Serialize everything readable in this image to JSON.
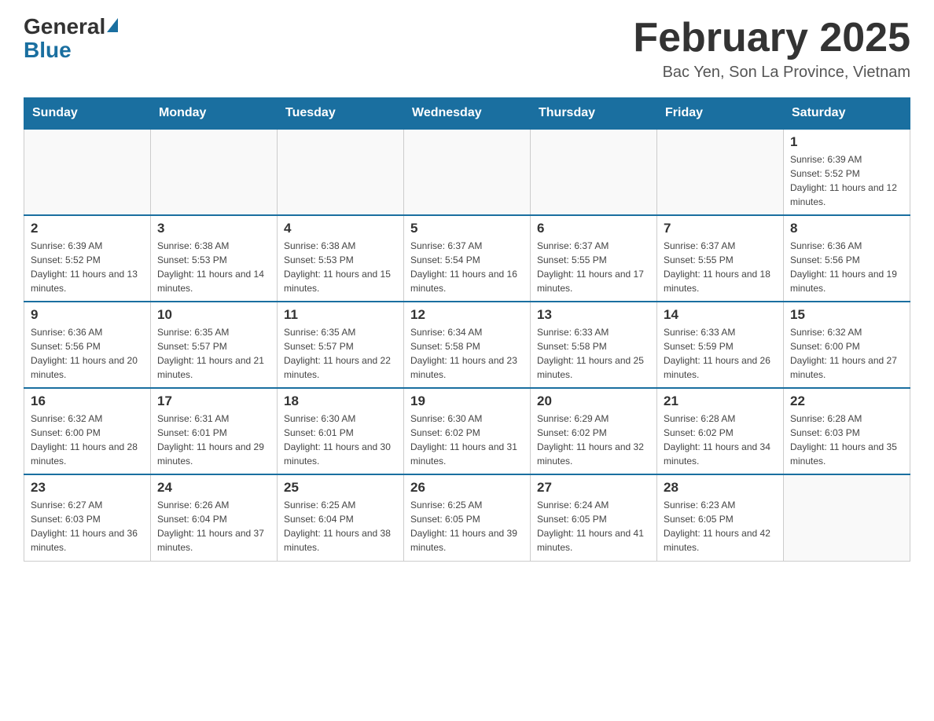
{
  "header": {
    "logo": {
      "general": "General",
      "blue": "Blue"
    },
    "title": "February 2025",
    "location": "Bac Yen, Son La Province, Vietnam"
  },
  "days_of_week": [
    "Sunday",
    "Monday",
    "Tuesday",
    "Wednesday",
    "Thursday",
    "Friday",
    "Saturday"
  ],
  "weeks": [
    [
      {
        "day": "",
        "info": ""
      },
      {
        "day": "",
        "info": ""
      },
      {
        "day": "",
        "info": ""
      },
      {
        "day": "",
        "info": ""
      },
      {
        "day": "",
        "info": ""
      },
      {
        "day": "",
        "info": ""
      },
      {
        "day": "1",
        "info": "Sunrise: 6:39 AM\nSunset: 5:52 PM\nDaylight: 11 hours and 12 minutes."
      }
    ],
    [
      {
        "day": "2",
        "info": "Sunrise: 6:39 AM\nSunset: 5:52 PM\nDaylight: 11 hours and 13 minutes."
      },
      {
        "day": "3",
        "info": "Sunrise: 6:38 AM\nSunset: 5:53 PM\nDaylight: 11 hours and 14 minutes."
      },
      {
        "day": "4",
        "info": "Sunrise: 6:38 AM\nSunset: 5:53 PM\nDaylight: 11 hours and 15 minutes."
      },
      {
        "day": "5",
        "info": "Sunrise: 6:37 AM\nSunset: 5:54 PM\nDaylight: 11 hours and 16 minutes."
      },
      {
        "day": "6",
        "info": "Sunrise: 6:37 AM\nSunset: 5:55 PM\nDaylight: 11 hours and 17 minutes."
      },
      {
        "day": "7",
        "info": "Sunrise: 6:37 AM\nSunset: 5:55 PM\nDaylight: 11 hours and 18 minutes."
      },
      {
        "day": "8",
        "info": "Sunrise: 6:36 AM\nSunset: 5:56 PM\nDaylight: 11 hours and 19 minutes."
      }
    ],
    [
      {
        "day": "9",
        "info": "Sunrise: 6:36 AM\nSunset: 5:56 PM\nDaylight: 11 hours and 20 minutes."
      },
      {
        "day": "10",
        "info": "Sunrise: 6:35 AM\nSunset: 5:57 PM\nDaylight: 11 hours and 21 minutes."
      },
      {
        "day": "11",
        "info": "Sunrise: 6:35 AM\nSunset: 5:57 PM\nDaylight: 11 hours and 22 minutes."
      },
      {
        "day": "12",
        "info": "Sunrise: 6:34 AM\nSunset: 5:58 PM\nDaylight: 11 hours and 23 minutes."
      },
      {
        "day": "13",
        "info": "Sunrise: 6:33 AM\nSunset: 5:58 PM\nDaylight: 11 hours and 25 minutes."
      },
      {
        "day": "14",
        "info": "Sunrise: 6:33 AM\nSunset: 5:59 PM\nDaylight: 11 hours and 26 minutes."
      },
      {
        "day": "15",
        "info": "Sunrise: 6:32 AM\nSunset: 6:00 PM\nDaylight: 11 hours and 27 minutes."
      }
    ],
    [
      {
        "day": "16",
        "info": "Sunrise: 6:32 AM\nSunset: 6:00 PM\nDaylight: 11 hours and 28 minutes."
      },
      {
        "day": "17",
        "info": "Sunrise: 6:31 AM\nSunset: 6:01 PM\nDaylight: 11 hours and 29 minutes."
      },
      {
        "day": "18",
        "info": "Sunrise: 6:30 AM\nSunset: 6:01 PM\nDaylight: 11 hours and 30 minutes."
      },
      {
        "day": "19",
        "info": "Sunrise: 6:30 AM\nSunset: 6:02 PM\nDaylight: 11 hours and 31 minutes."
      },
      {
        "day": "20",
        "info": "Sunrise: 6:29 AM\nSunset: 6:02 PM\nDaylight: 11 hours and 32 minutes."
      },
      {
        "day": "21",
        "info": "Sunrise: 6:28 AM\nSunset: 6:02 PM\nDaylight: 11 hours and 34 minutes."
      },
      {
        "day": "22",
        "info": "Sunrise: 6:28 AM\nSunset: 6:03 PM\nDaylight: 11 hours and 35 minutes."
      }
    ],
    [
      {
        "day": "23",
        "info": "Sunrise: 6:27 AM\nSunset: 6:03 PM\nDaylight: 11 hours and 36 minutes."
      },
      {
        "day": "24",
        "info": "Sunrise: 6:26 AM\nSunset: 6:04 PM\nDaylight: 11 hours and 37 minutes."
      },
      {
        "day": "25",
        "info": "Sunrise: 6:25 AM\nSunset: 6:04 PM\nDaylight: 11 hours and 38 minutes."
      },
      {
        "day": "26",
        "info": "Sunrise: 6:25 AM\nSunset: 6:05 PM\nDaylight: 11 hours and 39 minutes."
      },
      {
        "day": "27",
        "info": "Sunrise: 6:24 AM\nSunset: 6:05 PM\nDaylight: 11 hours and 41 minutes."
      },
      {
        "day": "28",
        "info": "Sunrise: 6:23 AM\nSunset: 6:05 PM\nDaylight: 11 hours and 42 minutes."
      },
      {
        "day": "",
        "info": ""
      }
    ]
  ]
}
